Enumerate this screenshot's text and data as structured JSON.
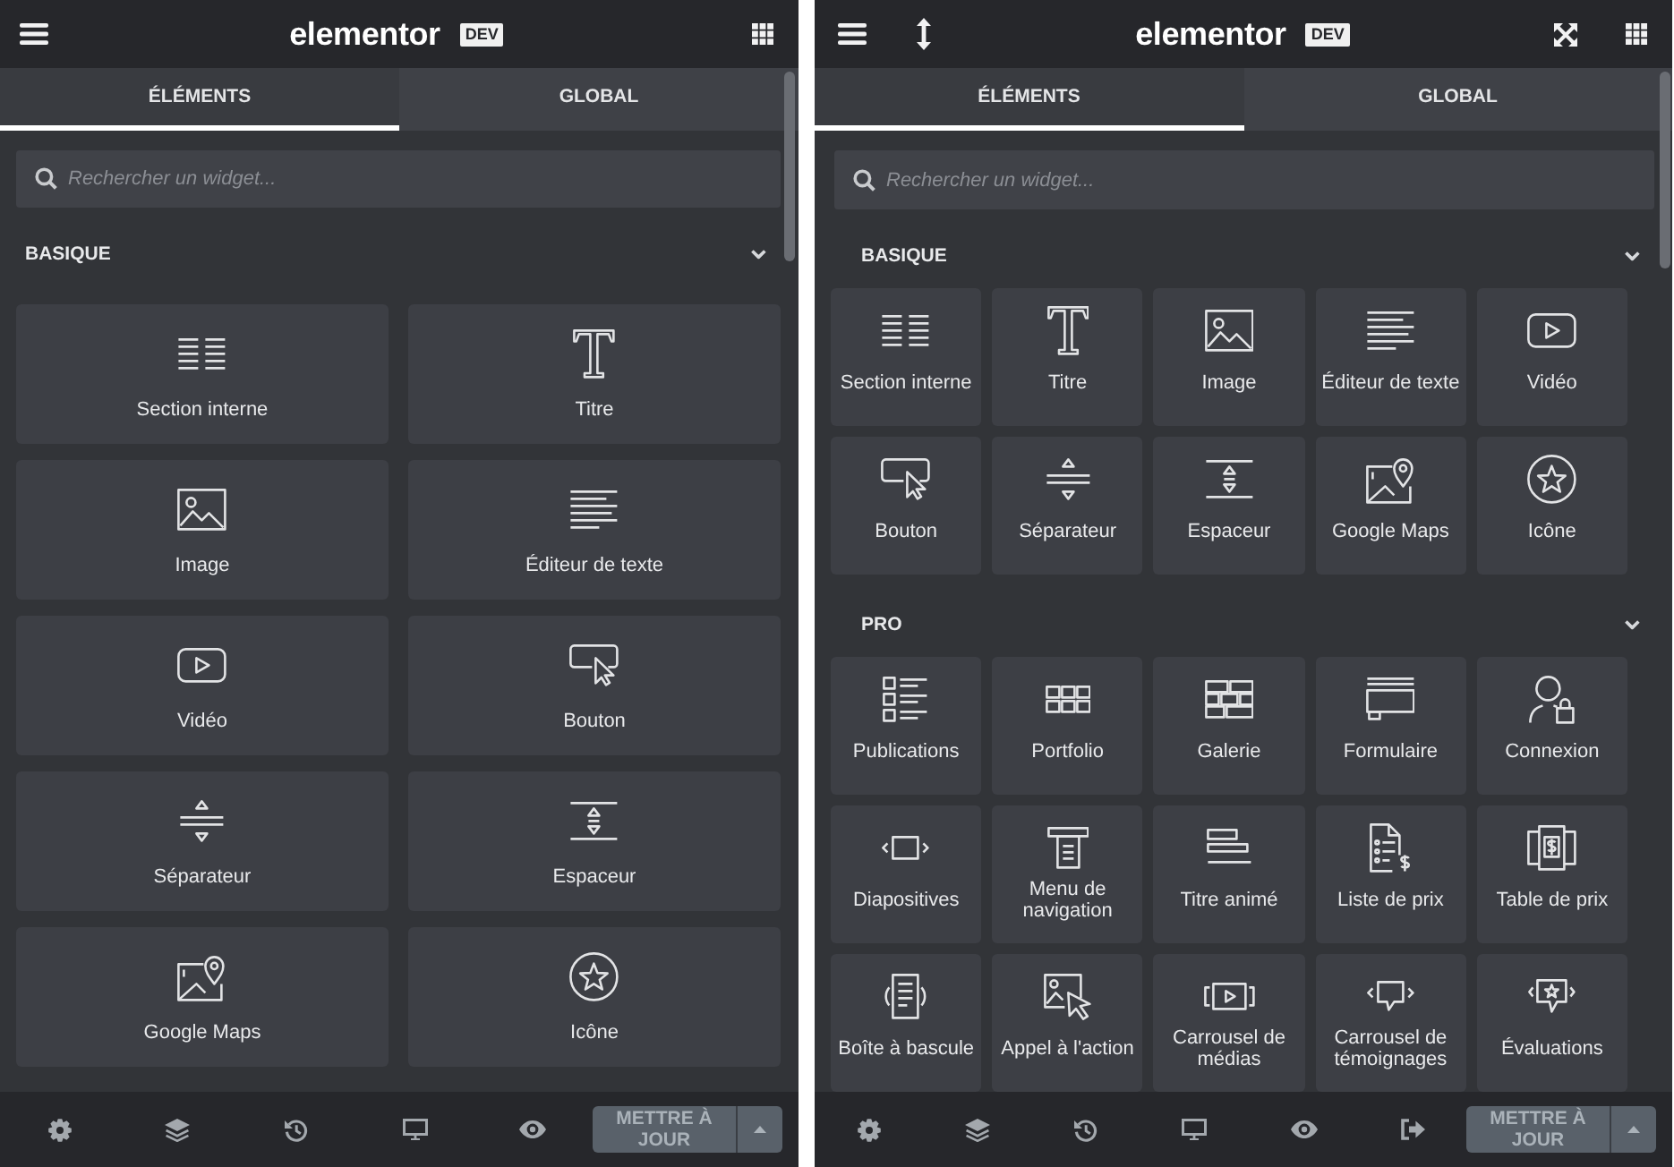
{
  "panels": [
    {
      "header": {
        "tools_left": [
          {
            "kind": "menu"
          }
        ],
        "logo": "elementor",
        "badge": "DEV",
        "tools_right": [
          {
            "kind": "apps"
          }
        ]
      },
      "tabs": [
        {
          "label": "ÉLÉMENTS",
          "selected": true
        },
        {
          "label": "GLOBAL",
          "selected": false
        }
      ],
      "search": {
        "placeholder": "Rechercher un widget..."
      },
      "categories": [
        {
          "title": "BASIQUE",
          "expanded": true,
          "widgets": [
            {
              "label": "Section interne",
              "kind": "inner-section"
            },
            {
              "label": "Titre",
              "kind": "heading"
            },
            {
              "label": "Image",
              "kind": "image"
            },
            {
              "label": "Éditeur de texte",
              "kind": "text-editor"
            },
            {
              "label": "Vidéo",
              "kind": "video"
            },
            {
              "label": "Bouton",
              "kind": "button"
            },
            {
              "label": "Séparateur",
              "kind": "divider"
            },
            {
              "label": "Espaceur",
              "kind": "spacer"
            },
            {
              "label": "Google Maps",
              "kind": "map"
            },
            {
              "label": "Icône",
              "kind": "icon"
            }
          ]
        }
      ],
      "footer": {
        "tools": [
          {
            "kind": "settings"
          },
          {
            "kind": "navigator"
          },
          {
            "kind": "history"
          },
          {
            "kind": "responsive"
          },
          {
            "kind": "preview"
          }
        ],
        "publish": {
          "label": "METTRE À JOUR",
          "disabled": true
        }
      }
    },
    {
      "header": {
        "tools_left": [
          {
            "kind": "menu"
          },
          {
            "kind": "resize"
          }
        ],
        "logo": "elementor",
        "badge": "DEV",
        "tools_right": [
          {
            "kind": "fullscreen"
          },
          {
            "kind": "apps"
          }
        ]
      },
      "tabs": [
        {
          "label": "ÉLÉMENTS",
          "selected": true
        },
        {
          "label": "GLOBAL",
          "selected": false
        }
      ],
      "search": {
        "placeholder": "Rechercher un widget..."
      },
      "categories": [
        {
          "title": "BASIQUE",
          "expanded": true,
          "widgets": [
            {
              "label": "Section interne",
              "kind": "inner-section"
            },
            {
              "label": "Titre",
              "kind": "heading"
            },
            {
              "label": "Image",
              "kind": "image"
            },
            {
              "label": "Éditeur de texte",
              "kind": "text-editor"
            },
            {
              "label": "Vidéo",
              "kind": "video"
            },
            {
              "label": "Bouton",
              "kind": "button"
            },
            {
              "label": "Séparateur",
              "kind": "divider"
            },
            {
              "label": "Espaceur",
              "kind": "spacer"
            },
            {
              "label": "Google Maps",
              "kind": "map"
            },
            {
              "label": "Icône",
              "kind": "icon"
            }
          ]
        },
        {
          "title": "PRO",
          "expanded": true,
          "widgets": [
            {
              "label": "Publications",
              "kind": "posts"
            },
            {
              "label": "Portfolio",
              "kind": "portfolio"
            },
            {
              "label": "Galerie",
              "kind": "gallery"
            },
            {
              "label": "Formulaire",
              "kind": "form"
            },
            {
              "label": "Connexion",
              "kind": "login"
            },
            {
              "label": "Diapositives",
              "kind": "slides"
            },
            {
              "label": "Menu de navigation",
              "kind": "nav-menu"
            },
            {
              "label": "Titre animé",
              "kind": "headline"
            },
            {
              "label": "Liste de prix",
              "kind": "price-list"
            },
            {
              "label": "Table de prix",
              "kind": "price-table"
            },
            {
              "label": "Boîte à bascule",
              "kind": "toggle"
            },
            {
              "label": "Appel à l'action",
              "kind": "cta"
            },
            {
              "label": "Carrousel de médias",
              "kind": "media-carousel"
            },
            {
              "label": "Carrousel de témoignages",
              "kind": "testimonial-carousel"
            },
            {
              "label": "Évaluations",
              "kind": "reviews"
            }
          ]
        }
      ],
      "footer": {
        "tools": [
          {
            "kind": "settings"
          },
          {
            "kind": "navigator"
          },
          {
            "kind": "history"
          },
          {
            "kind": "responsive"
          },
          {
            "kind": "preview"
          },
          {
            "kind": "exit"
          }
        ],
        "publish": {
          "label": "METTRE À JOUR",
          "disabled": true
        }
      }
    }
  ]
}
